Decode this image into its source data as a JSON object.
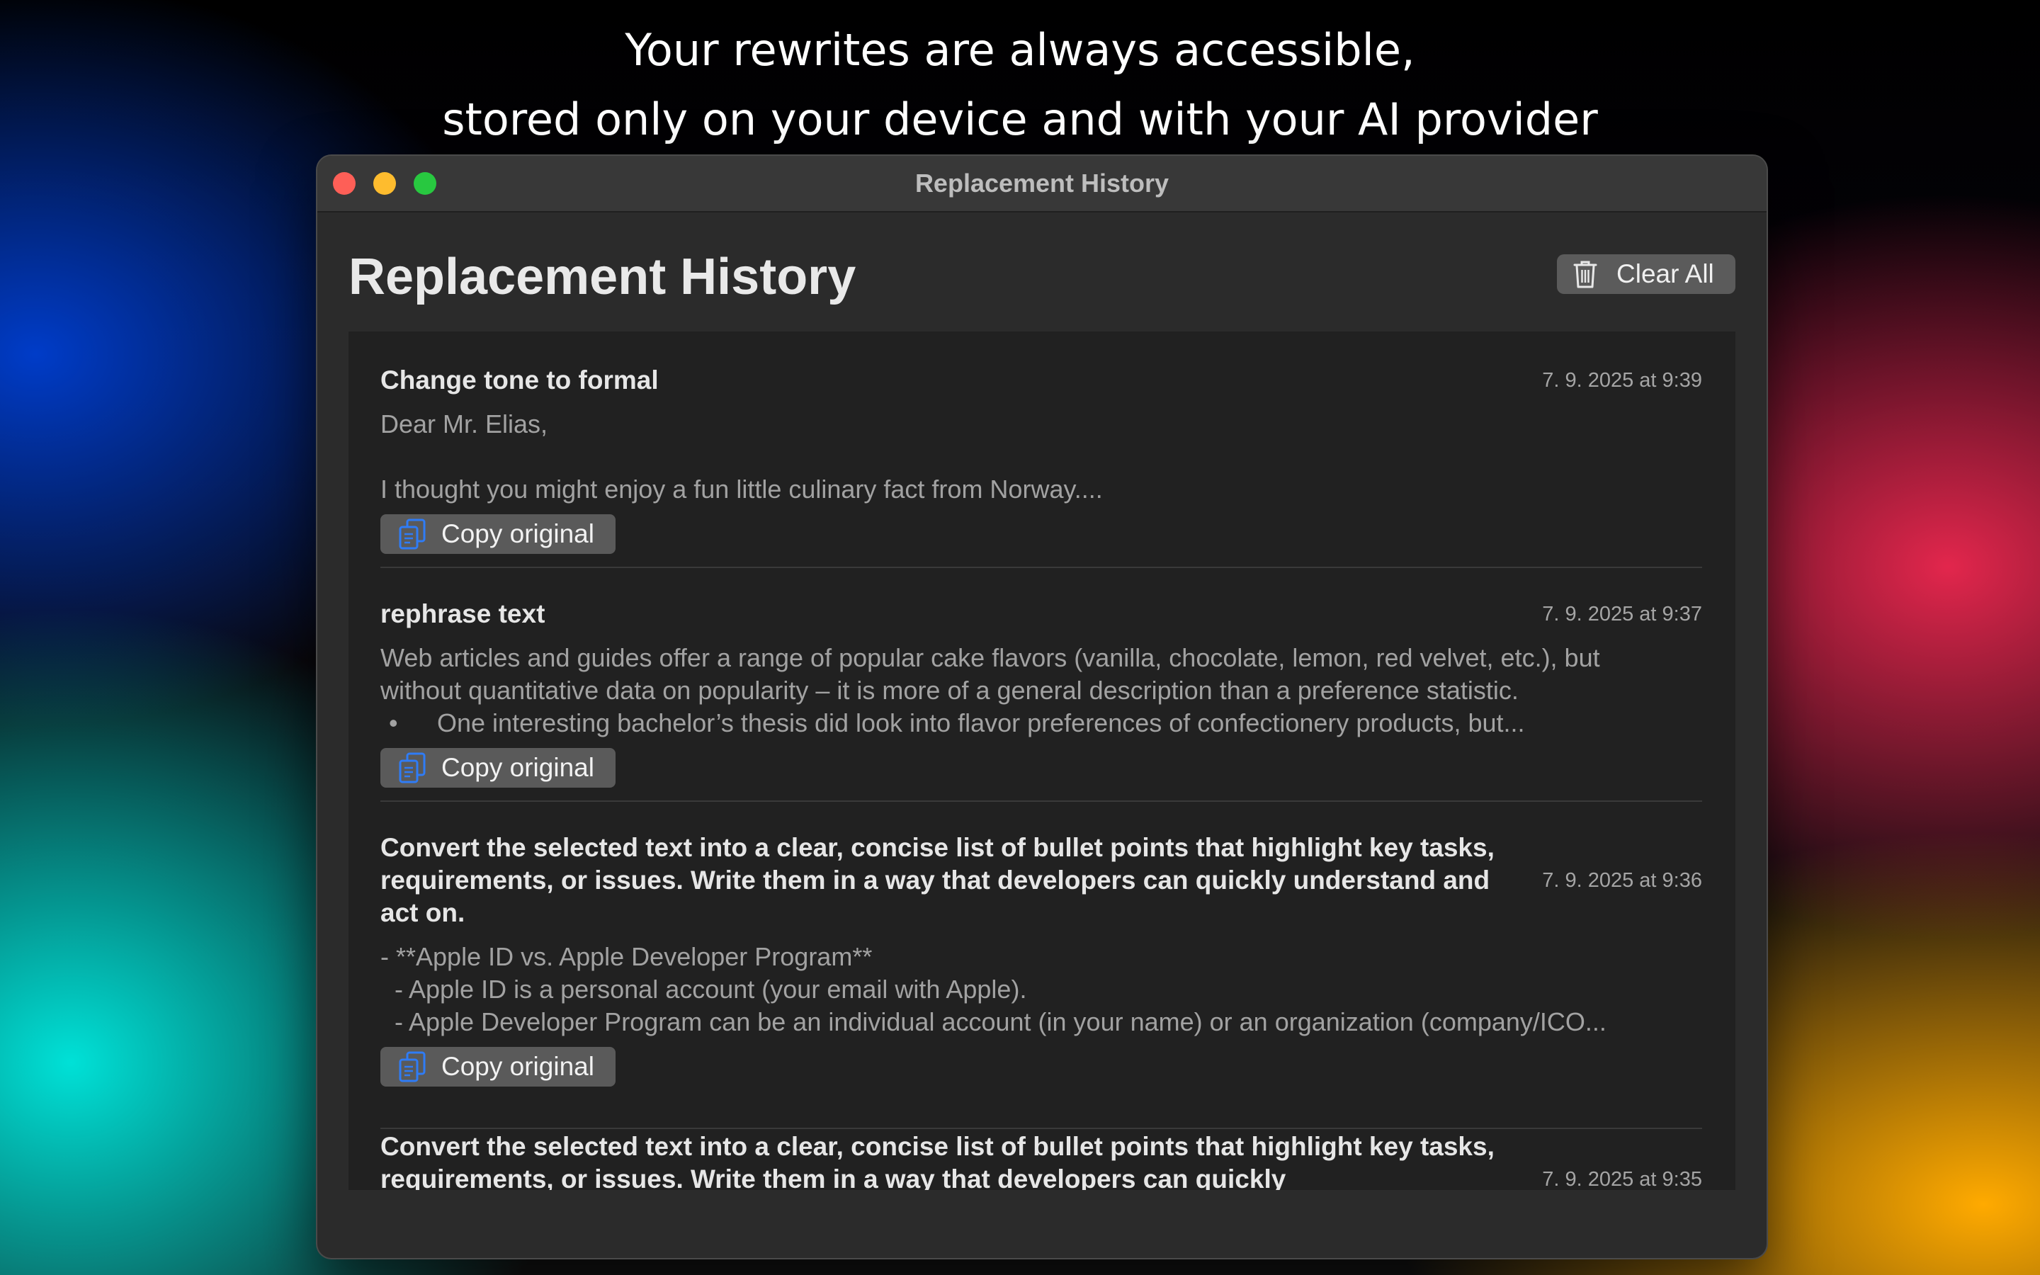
{
  "headline": {
    "line1": "Your rewrites are always accessible,",
    "line2": "stored only on your device and with your AI provider"
  },
  "window": {
    "title": "Replacement History",
    "traffic_lights": {
      "close": "#fe5f57",
      "minimize": "#febc2e",
      "zoom": "#28c840"
    }
  },
  "page": {
    "title": "Replacement History",
    "clear_all_label": "Clear All",
    "clear_all_icon": "trash-icon"
  },
  "entries": [
    {
      "title": "Change tone to formal",
      "date": "7. 9. 2025 at 9:39",
      "lines": [
        "Dear Mr. Elias,",
        "",
        "I thought you might enjoy a fun little culinary fact from Norway...."
      ],
      "copy_label": "Copy original"
    },
    {
      "title": "rephrase text",
      "date": "7. 9. 2025 at 9:37",
      "lines": [
        "Web articles and guides offer a range of popular cake flavors (vanilla, chocolate, lemon, red velvet, etc.), but",
        "without quantitative data on popularity – it is more of a general description than a preference statistic.",
        "One interesting bachelor’s thesis did look into flavor preferences of confectionery products, but..."
      ],
      "bullet": "•",
      "copy_label": "Copy original"
    },
    {
      "title": "Convert the selected text into a clear, concise list of bullet points that highlight key tasks, requirements, or issues. Write them in a way that developers can quickly understand and act on.",
      "date": "7. 9. 2025 at 9:36",
      "lines": [
        "- **Apple ID vs. Apple Developer Program**",
        "  - Apple ID is a personal account (your email with Apple).",
        "  - Apple Developer Program can be an individual account (in your name) or an organization (company/ICO..."
      ],
      "copy_label": "Copy original"
    },
    {
      "title": "Convert the selected text into a clear, concise list of bullet points that highlight key tasks, requirements, or issues. Write them in a way that developers can quickly",
      "date": "7. 9. 2025 at 9:35"
    }
  ],
  "copy_icon": "copy-documents-icon",
  "colors": {
    "accent_icon": "#2f7cf6",
    "window_bg": "#2b2b2b",
    "list_bg": "#212121"
  }
}
